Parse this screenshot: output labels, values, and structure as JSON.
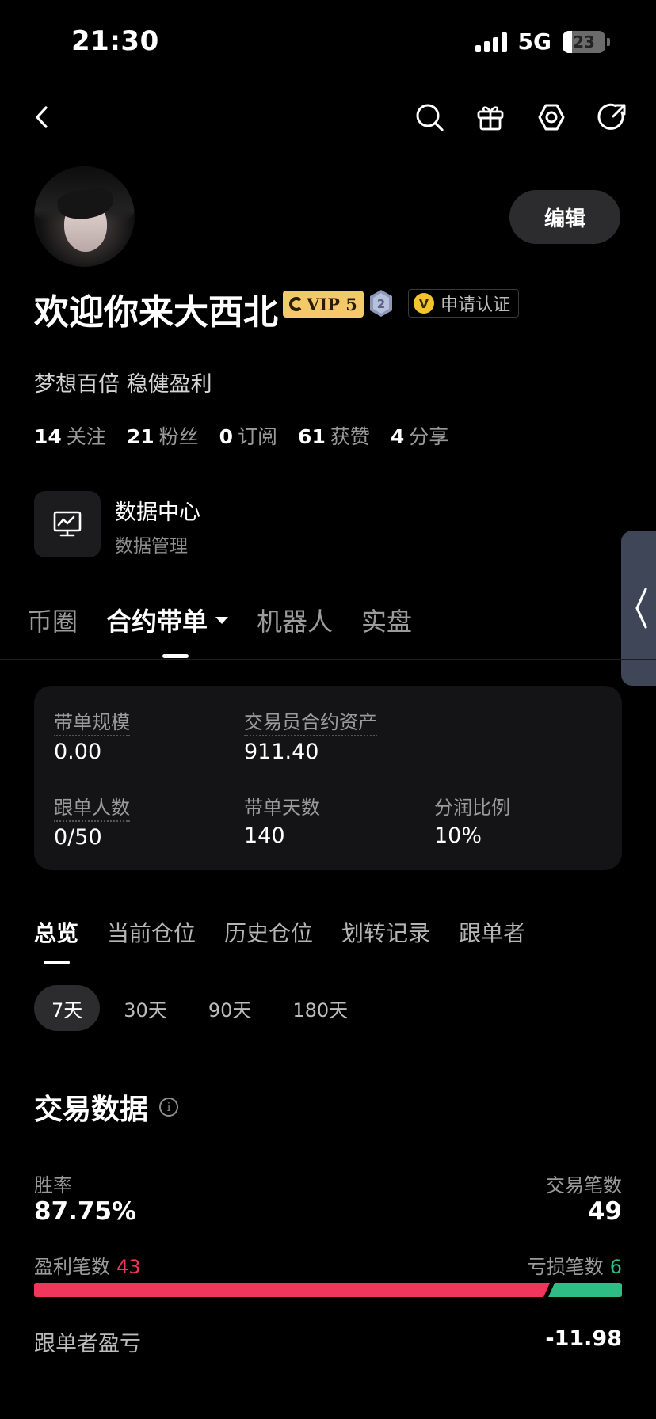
{
  "status_bar": {
    "time": "21:30",
    "network": "5G",
    "battery": "23",
    "battery_level": 0.23
  },
  "nav": {
    "back_icon": "chevron-left-icon",
    "actions": [
      "search-icon",
      "gift-icon",
      "settings-icon",
      "share-icon"
    ]
  },
  "profile": {
    "edit_label": "编辑",
    "username": "欢迎你来大西北",
    "vip_label": "VIP 5",
    "level": "2",
    "verify_badge": "V",
    "verify_label": "申请认证",
    "bio": "梦想百倍 稳健盈利",
    "stats": [
      {
        "num": "14",
        "label": "关注"
      },
      {
        "num": "21",
        "label": "粉丝"
      },
      {
        "num": "0",
        "label": "订阅"
      },
      {
        "num": "61",
        "label": "获赞"
      },
      {
        "num": "4",
        "label": "分享"
      }
    ]
  },
  "data_center": {
    "title": "数据中心",
    "subtitle": "数据管理"
  },
  "main_tabs": [
    "币圈",
    "合约带单",
    "机器人",
    "实盘"
  ],
  "summary": {
    "scale_label": "带单规模",
    "scale_value": "0.00",
    "assets_label": "交易员合约资产",
    "assets_value": "911.40",
    "followers_label": "跟单人数",
    "followers_value": "0/50",
    "days_label": "带单天数",
    "days_value": "140",
    "share_label": "分润比例",
    "share_value": "10%"
  },
  "sub_tabs": [
    "总览",
    "当前仓位",
    "历史仓位",
    "划转记录",
    "跟单者"
  ],
  "ranges": [
    "7天",
    "30天",
    "90天",
    "180天"
  ],
  "trading": {
    "title": "交易数据",
    "info_icon": "info-icon",
    "win_rate_label": "胜率",
    "win_rate_value": "87.75%",
    "trade_count_label": "交易笔数",
    "trade_count_value": "49",
    "profit_count_label": "盈利笔数",
    "profit_count_value": "43",
    "loss_count_label": "亏损笔数",
    "loss_count_value": "6",
    "profit_ratio": 0.8775,
    "follower_pnl_label": "跟单者盈亏",
    "follower_pnl_value": "-11.98"
  },
  "colors": {
    "profit": "#f0365a",
    "loss": "#2ebd85",
    "vip": "#f4c96a",
    "side_tab": "#3e4658"
  }
}
